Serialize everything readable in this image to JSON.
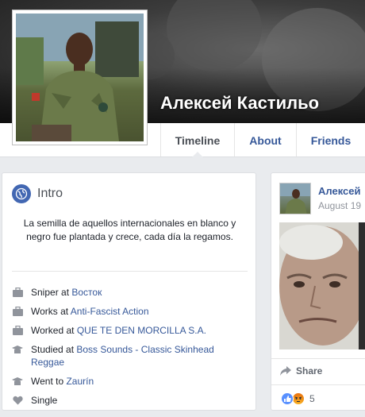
{
  "profile": {
    "name": "Алексей Кастильо"
  },
  "nav": {
    "tabs": [
      {
        "label": "Timeline",
        "active": true
      },
      {
        "label": "About",
        "active": false
      },
      {
        "label": "Friends",
        "active": false
      }
    ]
  },
  "intro": {
    "title": "Intro",
    "bio": "La semilla de aquellos internacionales en blanco y negro fue plantada y crece, cada día la regamos.",
    "items": [
      {
        "icon": "briefcase-icon",
        "prefix": "Sniper at ",
        "link": "Восток"
      },
      {
        "icon": "briefcase-icon",
        "prefix": "Works at ",
        "link": "Anti-Fascist Action"
      },
      {
        "icon": "briefcase-icon",
        "prefix": "Worked at ",
        "link": "QUE TE DEN MORCILLA S.A."
      },
      {
        "icon": "graduation-cap-icon",
        "prefix": "Studied at ",
        "link": "Boss Sounds - Classic Skinhead Reggae"
      },
      {
        "icon": "graduation-cap-icon",
        "prefix": "Went to ",
        "link": "Zaurín"
      },
      {
        "icon": "heart-icon",
        "prefix": "Single",
        "link": ""
      }
    ]
  },
  "post": {
    "author": "Алексей",
    "date": "August 19",
    "share_label": "Share",
    "reaction_count": "5"
  },
  "colors": {
    "link": "#365899",
    "accent": "#4267b2",
    "background": "#e9ebee"
  }
}
